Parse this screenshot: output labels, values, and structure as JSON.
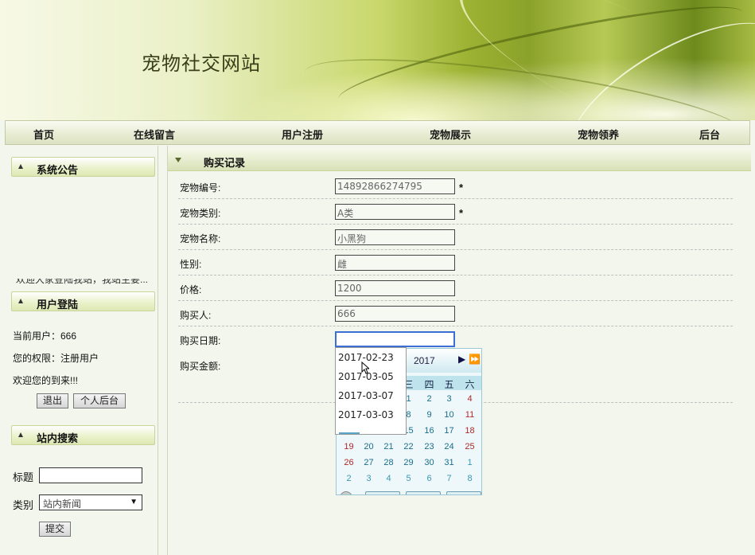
{
  "site": {
    "title": "宠物社交网站"
  },
  "nav": [
    "首页",
    "在线留言",
    "用户注册",
    "宠物展示",
    "宠物领养",
    "后台"
  ],
  "sidebar": {
    "notice": {
      "title": "系统公告",
      "text": "欢迎大家登陆我站，我站主要..."
    },
    "login": {
      "title": "用户登陆",
      "current_user": "当前用户：666",
      "role": "您的权限：注册用户",
      "welcome": "欢迎您的到来!!!",
      "logout_btn": "退出",
      "personal_btn": "个人后台"
    },
    "search": {
      "title": "站内搜索",
      "title_label": "标题",
      "title_value": "",
      "category_label": "类别",
      "category_value": "站内新闻",
      "submit_btn": "提交"
    }
  },
  "main": {
    "heading": "购买记录",
    "fields": [
      {
        "label": "宠物编号:",
        "value": "14892866274795",
        "required": "*"
      },
      {
        "label": "宠物类别:",
        "value": "A类",
        "required": "*"
      },
      {
        "label": "宠物名称:",
        "value": "小黑狗",
        "required": ""
      },
      {
        "label": "性别:",
        "value": "雌",
        "required": ""
      },
      {
        "label": "价格:",
        "value": "1200",
        "required": ""
      },
      {
        "label": "购买人:",
        "value": "666",
        "required": ""
      },
      {
        "label": "购买日期:",
        "value": "",
        "required": ""
      },
      {
        "label": "购买金额:",
        "value": "",
        "required": ""
      }
    ]
  },
  "autocomplete": [
    "2017-02-23",
    "2017-03-05",
    "2017-03-07",
    "2017-03-03"
  ],
  "datepicker": {
    "year": "2017",
    "weekdays": [
      "三",
      "四",
      "五",
      "六"
    ],
    "rows": [
      [
        "1",
        "2",
        "3",
        "4"
      ],
      [
        "8",
        "9",
        "10",
        "11"
      ],
      [
        "15",
        "16",
        "17",
        "18"
      ],
      [
        "19",
        "20",
        "21",
        "22",
        "23",
        "24",
        "25"
      ],
      [
        "26",
        "27",
        "28",
        "29",
        "30",
        "31",
        "1"
      ],
      [
        "2",
        "3",
        "4",
        "5",
        "6",
        "7",
        "8"
      ]
    ]
  }
}
